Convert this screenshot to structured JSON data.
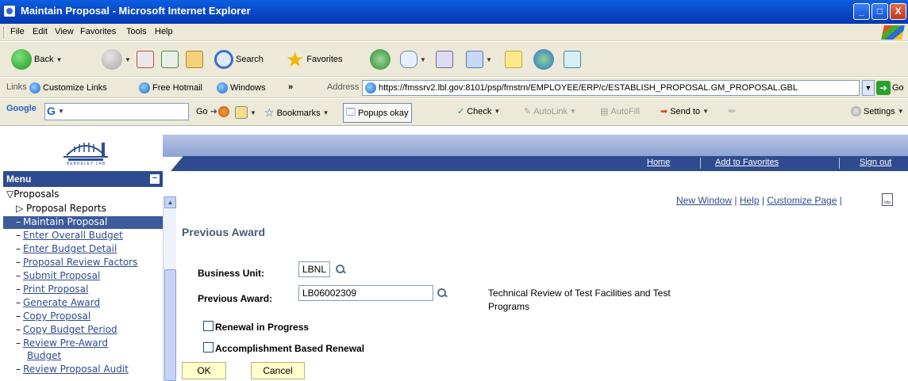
{
  "window": {
    "title": "Maintain Proposal - Microsoft Internet Explorer",
    "controls": [
      "_",
      "□",
      "X"
    ]
  },
  "menubar": {
    "items": [
      "File",
      "Edit",
      "View",
      "Favorites",
      "Tools",
      "Help"
    ]
  },
  "toolbar": {
    "back_label": "Back",
    "search_label": "Search",
    "favorites_label": "Favorites"
  },
  "addressbar": {
    "links_label": "Links",
    "links": [
      "Customize Links",
      "Free Hotmail",
      "Windows"
    ],
    "chevron": "»",
    "address_label": "Address",
    "url": "https://fmssrv2.lbl.gov:8101/psp/fmstrn/EMPLOYEE/ERP/c/ESTABLISH_PROPOSAL.GM_PROPOSAL.GBL",
    "go_label": "Go"
  },
  "google_toolbar": {
    "logo": "Google",
    "g_button": "G",
    "go_label": "Go",
    "bookmarks_label": "Bookmarks",
    "popups_label": "Popups okay",
    "check_label": "Check",
    "autolink_label": "AutoLink",
    "autofill_label": "AutoFill",
    "sendto_label": "Send to",
    "settings_label": "Settings"
  },
  "header": {
    "logo_text": "BERKELEY LAB",
    "nav": [
      "Home",
      "Add to Favorites",
      "Sign out"
    ]
  },
  "menu": {
    "title": "Menu",
    "minimize": "−",
    "folder": "Proposals",
    "items": [
      {
        "label": "Proposal Reports",
        "type": "folder"
      },
      {
        "label": "Maintain Proposal",
        "type": "selected"
      },
      {
        "label": "Enter Overall Budget",
        "type": "link"
      },
      {
        "label": "Enter Budget Detail",
        "type": "link"
      },
      {
        "label": "Proposal Review Factors",
        "type": "link"
      },
      {
        "label": "Submit Proposal",
        "type": "link"
      },
      {
        "label": "Print Proposal",
        "type": "link"
      },
      {
        "label": "Generate Award",
        "type": "link"
      },
      {
        "label": "Copy Proposal",
        "type": "link"
      },
      {
        "label": "Copy Budget Period",
        "type": "link"
      },
      {
        "label": "Review Pre-Award",
        "type": "link"
      },
      {
        "label": "Budget",
        "type": "link"
      },
      {
        "label": "Review Proposal Audit",
        "type": "link"
      }
    ]
  },
  "content": {
    "toplinks": [
      "New Window",
      "Help",
      "Customize Page"
    ],
    "separator": "|",
    "http_icon": "http",
    "page_title": "Previous Award",
    "business_unit_label": "Business Unit:",
    "business_unit_value": "LBNL",
    "previous_award_label": "Previous Award:",
    "previous_award_value": "LB06002309",
    "award_description": "Technical Review of Test Facilities and Test Programs",
    "renewal_label": "Renewal in Progress",
    "accomplishment_label": "Accomplishment Based Renewal",
    "ok_label": "OK",
    "cancel_label": "Cancel"
  }
}
